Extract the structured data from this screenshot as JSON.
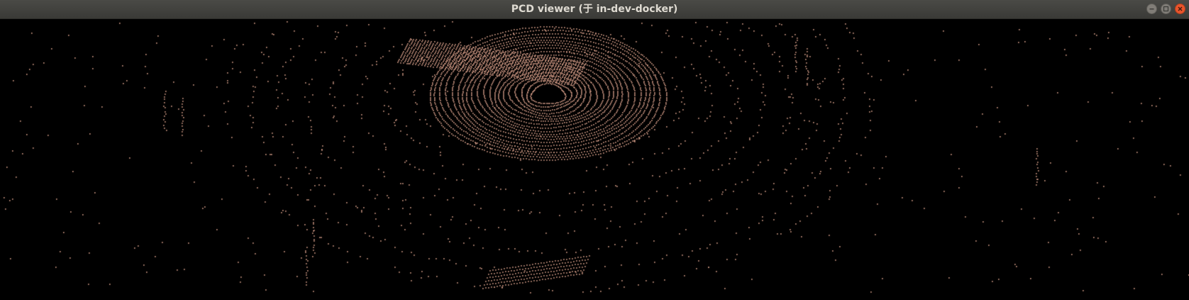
{
  "window": {
    "title": "PCD viewer (于 in-dev-docker)"
  },
  "controls": {
    "minimize_icon": "minimize-icon",
    "maximize_icon": "maximize-icon",
    "close_icon": "close-icon"
  },
  "colors": {
    "titlebar": "#3f3f3c",
    "title_text": "#dfdbd2",
    "close_button": "#e9552c",
    "background": "#000000",
    "point": "#d9a08a"
  }
}
